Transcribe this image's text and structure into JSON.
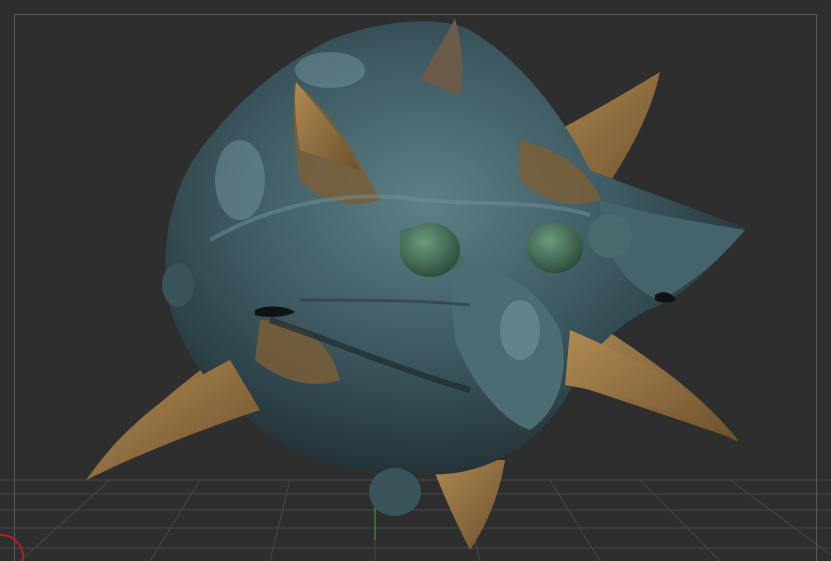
{
  "viewport": {
    "background": "#2e2e2e",
    "grid_color": "#4a4a4a",
    "border_color": "#5a5a5a"
  },
  "model": {
    "body_color": "#3e5a63",
    "body_shadow": "#2a3b42",
    "highlight": "#6f8f96",
    "spike_color": "#8a6a3e",
    "spike_light": "#a7834e",
    "moss_color": "#3f6a52"
  },
  "gizmo": {
    "ring_color": "#b02020",
    "icon": "view-orientation-gizmo"
  }
}
